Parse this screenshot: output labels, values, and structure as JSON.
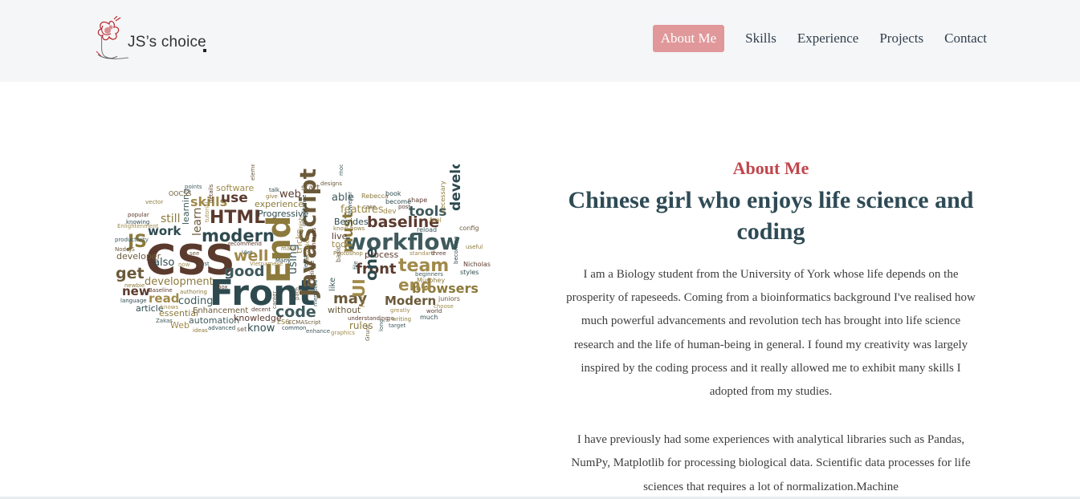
{
  "header": {
    "logo_text": "JS’s choice",
    "nav": [
      {
        "label": "About Me",
        "active": true
      },
      {
        "label": "Skills",
        "active": false
      },
      {
        "label": "Experience",
        "active": false
      },
      {
        "label": "Projects",
        "active": false
      },
      {
        "label": "Contact",
        "active": false
      }
    ]
  },
  "about": {
    "section_label": "About Me",
    "headline": "Chinese girl who enjoys life science and coding",
    "paragraph_1": "I am a Biology student from the University of York whose life depends on the prosperity of rapeseeds. Coming from a bioinformatics background I've realised how much powerful advancements and revolution tech has brought into life science research and the life of human-being in general. I found my creativity was largely inspired by the coding process and it really allowed me to exhibit many skills I adopted from my studies.",
    "paragraph_2": "I have previously had some experiences with analytical libraries such as Pandas, NumPy, Matplotlib for processing biological data. Scientific data processes for life sciences that requires a lot of normalization.Machine"
  },
  "word_cloud": {
    "words": [
      "CSS",
      "Front",
      "End",
      "JavaScript",
      "workflow",
      "team",
      "HTML",
      "modern",
      "JS",
      "get",
      "good",
      "well",
      "baseline",
      "developers",
      "browsers",
      "Modern",
      "code",
      "end",
      "front",
      "one",
      "must",
      "may",
      "tools",
      "skills",
      "use",
      "work",
      "still",
      "learn",
      "learning",
      "software",
      "web",
      "Progressive",
      "experience",
      "start",
      "able",
      "features",
      "process",
      "also",
      "development",
      "developer",
      "coding",
      "read",
      "new",
      "article",
      "essential",
      "Enhancement",
      "automation",
      "Web",
      "knowledge",
      "know",
      "rules",
      "without",
      "like",
      "tool",
      "live",
      "Besides",
      "Photoshop",
      "basic",
      "using",
      "tricks",
      "Nicholas",
      "styles",
      "necessary",
      "config",
      "reload",
      "feel",
      "shape",
      "book",
      "Rebecca",
      "designs",
      "modules",
      "dev",
      "post",
      "become",
      "Murphey",
      "juniors",
      "beginners",
      "choose",
      "world",
      "much",
      "writing",
      "go",
      "target",
      "greatly",
      "understanding",
      "common",
      "ES6",
      "ECMAScript",
      "enhance",
      "graphics",
      "decent",
      "advanced",
      "ideas",
      "set",
      "Zakas",
      "knows",
      "Baseline",
      "language",
      "newbie",
      "NodeJS",
      "productivity",
      "Enlightenment",
      "popular",
      "knowing",
      "vector",
      "OOCSS",
      "points",
      "tutorial",
      "details",
      "talk",
      "give",
      "elements",
      "Viet",
      "Vietnamese",
      "recommend",
      "Many",
      "make",
      "see",
      "just",
      "now",
      "box",
      "ask",
      "authoring",
      "path",
      "members",
      "technical",
      "concepts",
      "inheritance",
      "know-hows",
      "case",
      "however",
      "standard",
      "three",
      "becoming",
      "useful",
      "Grunt",
      "long",
      "Part",
      "believe",
      "least",
      "finish",
      "career",
      "file",
      "UI"
    ],
    "colors": [
      "#5b3a2e",
      "#2e4a4f",
      "#8c7a3c",
      "#6b5a3a",
      "#3f5a5c",
      "#a08a4a"
    ]
  }
}
